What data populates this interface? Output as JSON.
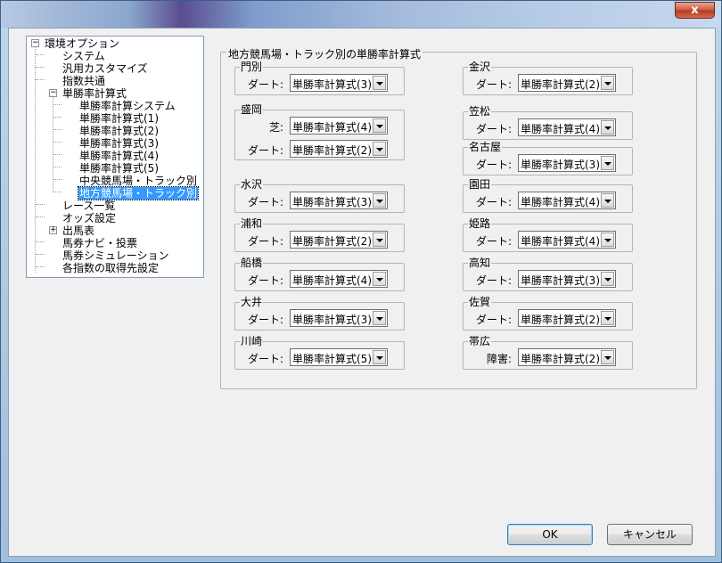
{
  "window": {
    "close_label": "x"
  },
  "tree": {
    "items": [
      {
        "label": "環境オプション",
        "level": 0,
        "expander": "−"
      },
      {
        "label": "システム",
        "level": 1
      },
      {
        "label": "汎用カスタマイズ",
        "level": 1
      },
      {
        "label": "指数共通",
        "level": 1
      },
      {
        "label": "単勝率計算式",
        "level": 1,
        "expander": "−"
      },
      {
        "label": "単勝率計算システム",
        "level": 2
      },
      {
        "label": "単勝率計算式(1)",
        "level": 2
      },
      {
        "label": "単勝率計算式(2)",
        "level": 2
      },
      {
        "label": "単勝率計算式(3)",
        "level": 2
      },
      {
        "label": "単勝率計算式(4)",
        "level": 2
      },
      {
        "label": "単勝率計算式(5)",
        "level": 2
      },
      {
        "label": "中央競馬場・トラック別",
        "level": 2
      },
      {
        "label": "地方競馬場・トラック別",
        "level": 2,
        "selected": true
      },
      {
        "label": "レース一覧",
        "level": 1
      },
      {
        "label": "オッズ設定",
        "level": 1
      },
      {
        "label": "出馬表",
        "level": 1,
        "expander": "+"
      },
      {
        "label": "馬券ナビ・投票",
        "level": 1
      },
      {
        "label": "馬券シミュレーション",
        "level": 1
      },
      {
        "label": "各指数の取得先設定",
        "level": 1
      }
    ]
  },
  "settings": {
    "group_title": "地方競馬場・トラック別の単勝率計算式",
    "venues": {
      "monbetsu": {
        "name": "門別",
        "rows": [
          {
            "label": "ダート:",
            "value": "単勝率計算式(3)"
          }
        ]
      },
      "morioka": {
        "name": "盛岡",
        "rows": [
          {
            "label": "芝:",
            "value": "単勝率計算式(4)"
          },
          {
            "label": "ダート:",
            "value": "単勝率計算式(2)"
          }
        ]
      },
      "mizusawa": {
        "name": "水沢",
        "rows": [
          {
            "label": "ダート:",
            "value": "単勝率計算式(3)"
          }
        ]
      },
      "urawa": {
        "name": "浦和",
        "rows": [
          {
            "label": "ダート:",
            "value": "単勝率計算式(2)"
          }
        ]
      },
      "funabashi": {
        "name": "船橋",
        "rows": [
          {
            "label": "ダート:",
            "value": "単勝率計算式(4)"
          }
        ]
      },
      "ooi": {
        "name": "大井",
        "rows": [
          {
            "label": "ダート:",
            "value": "単勝率計算式(3)"
          }
        ]
      },
      "kawasaki": {
        "name": "川崎",
        "rows": [
          {
            "label": "ダート:",
            "value": "単勝率計算式(5)"
          }
        ]
      },
      "kanazawa": {
        "name": "金沢",
        "rows": [
          {
            "label": "ダート:",
            "value": "単勝率計算式(2)"
          }
        ]
      },
      "kasamatsu": {
        "name": "笠松",
        "rows": [
          {
            "label": "ダート:",
            "value": "単勝率計算式(4)"
          }
        ]
      },
      "nagoya": {
        "name": "名古屋",
        "rows": [
          {
            "label": "ダート:",
            "value": "単勝率計算式(3)"
          }
        ]
      },
      "sonoda": {
        "name": "園田",
        "rows": [
          {
            "label": "ダート:",
            "value": "単勝率計算式(4)"
          }
        ]
      },
      "himeji": {
        "name": "姫路",
        "rows": [
          {
            "label": "ダート:",
            "value": "単勝率計算式(4)"
          }
        ]
      },
      "kochi": {
        "name": "高知",
        "rows": [
          {
            "label": "ダート:",
            "value": "単勝率計算式(3)"
          }
        ]
      },
      "saga": {
        "name": "佐賀",
        "rows": [
          {
            "label": "ダート:",
            "value": "単勝率計算式(2)"
          }
        ]
      },
      "obihiro": {
        "name": "帯広",
        "rows": [
          {
            "label": "障害:",
            "value": "単勝率計算式(2)"
          }
        ]
      }
    }
  },
  "buttons": {
    "ok": "OK",
    "cancel": "キャンセル"
  }
}
